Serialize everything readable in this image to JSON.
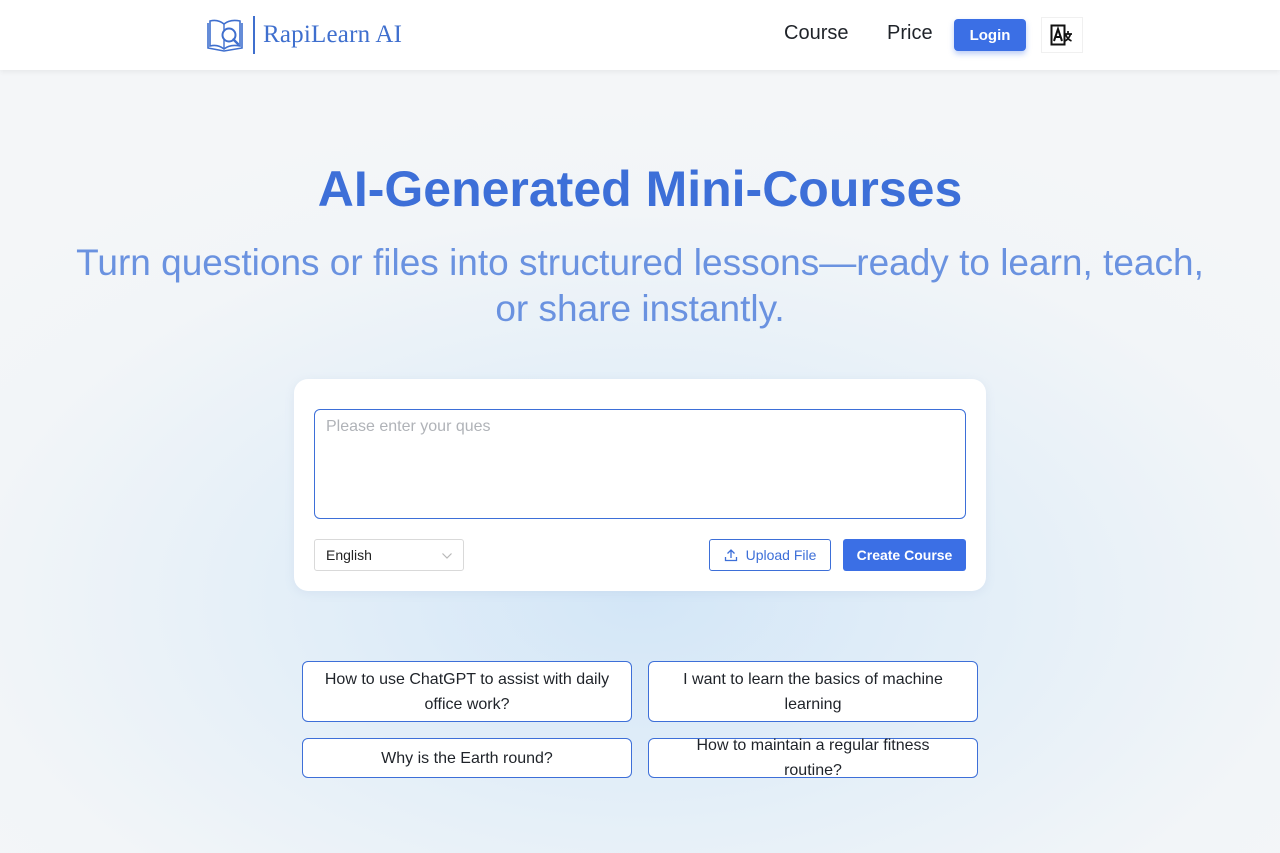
{
  "header": {
    "brand": "RapiLearn AI",
    "nav": {
      "course": "Course",
      "price": "Price"
    },
    "login_label": "Login",
    "language_icon": "translate-icon"
  },
  "hero": {
    "title": "AI-Generated Mini-Courses",
    "subtitle": "Turn questions or files into structured lessons—ready to learn, teach, or share instantly."
  },
  "composer": {
    "question_value": "",
    "question_placeholder": "Please enter your ques",
    "language_selected": "English",
    "upload_label": "Upload File",
    "create_label": "Create Course"
  },
  "suggestions": [
    "How to use ChatGPT to assist with daily office work?",
    "I want to learn the basics of machine learning",
    "Why is the Earth round?",
    "How to maintain a regular fitness routine?"
  ],
  "colors": {
    "accent": "#3b6fe5",
    "brand": "#3f6fce",
    "title": "#3d6fd8",
    "subtitle": "#6a92e0"
  }
}
